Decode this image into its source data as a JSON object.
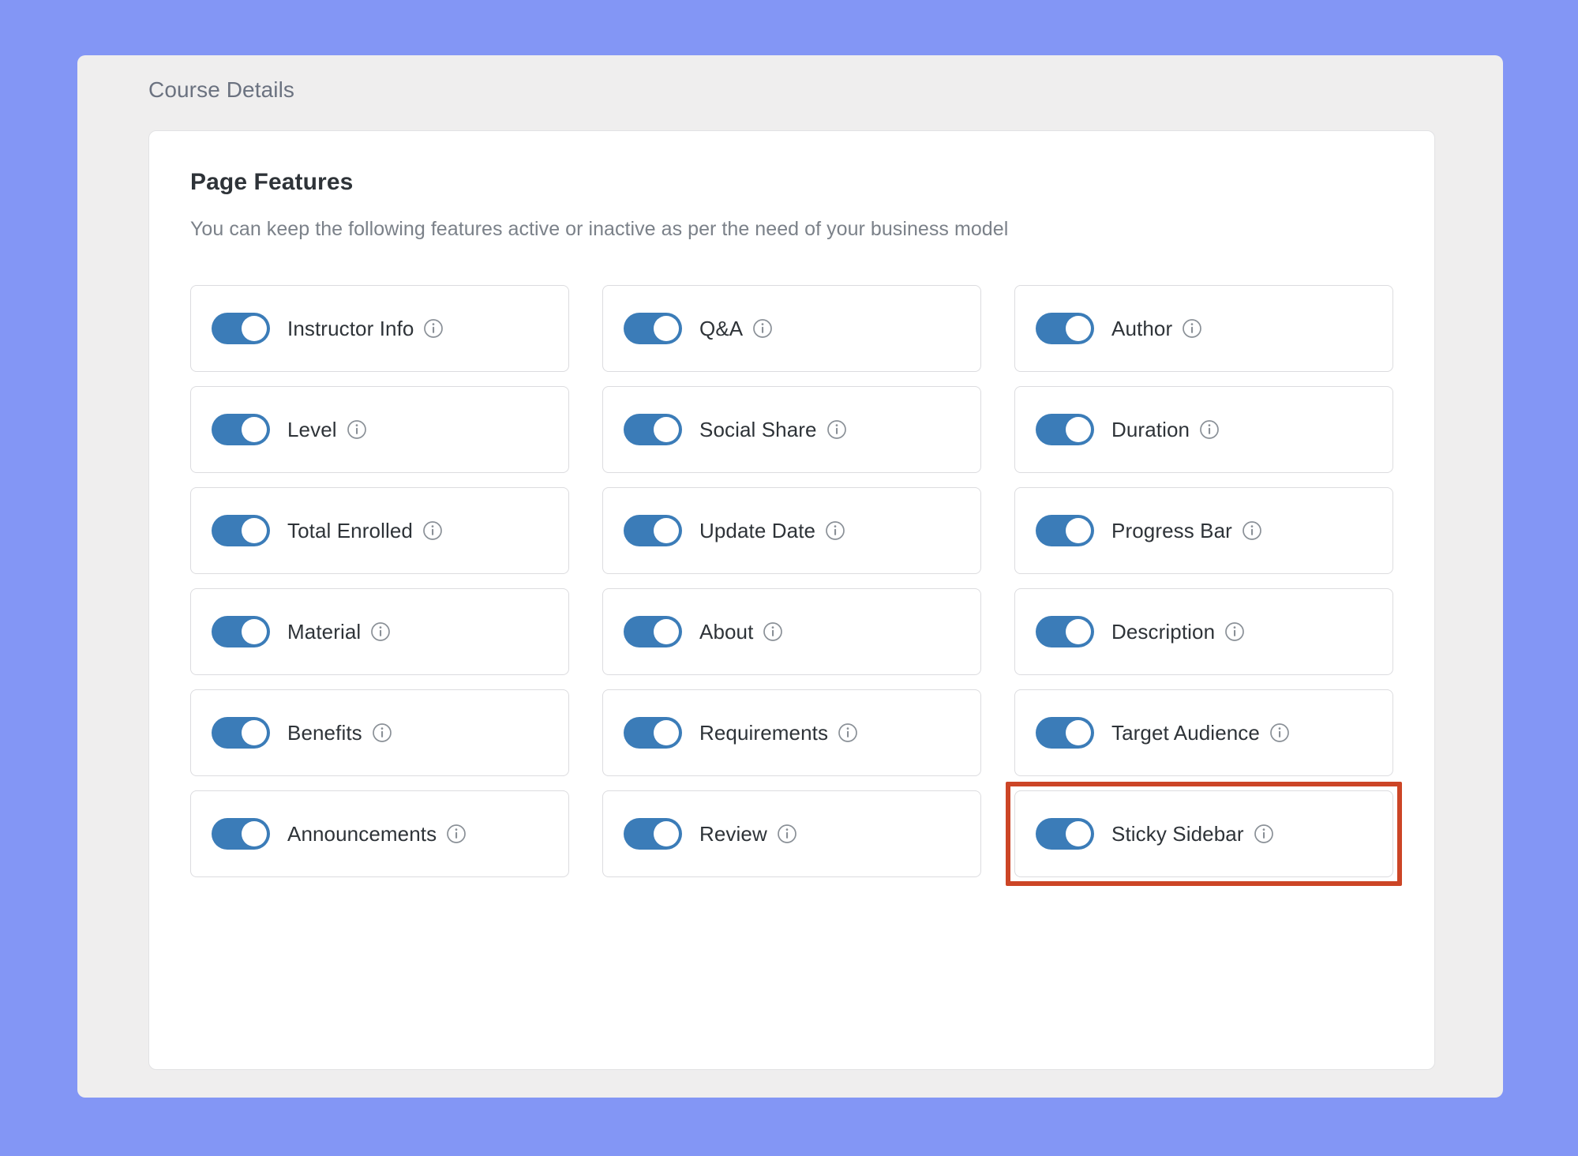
{
  "page": {
    "background_color": "#8396f5",
    "panel_color": "#efeeee",
    "card_color": "#ffffff",
    "accent_color": "#3b7cb8",
    "highlight_color": "#cc4526"
  },
  "panel": {
    "title": "Course Details"
  },
  "section": {
    "title": "Page Features",
    "subtitle": "You can keep the following features active or inactive as per the need of your business model"
  },
  "icons": {
    "info": "info-icon"
  },
  "features": [
    {
      "label": "Instructor Info",
      "enabled": true,
      "highlighted": false
    },
    {
      "label": "Q&A",
      "enabled": true,
      "highlighted": false
    },
    {
      "label": "Author",
      "enabled": true,
      "highlighted": false
    },
    {
      "label": "Level",
      "enabled": true,
      "highlighted": false
    },
    {
      "label": "Social Share",
      "enabled": true,
      "highlighted": false
    },
    {
      "label": "Duration",
      "enabled": true,
      "highlighted": false
    },
    {
      "label": "Total Enrolled",
      "enabled": true,
      "highlighted": false
    },
    {
      "label": "Update Date",
      "enabled": true,
      "highlighted": false
    },
    {
      "label": "Progress Bar",
      "enabled": true,
      "highlighted": false
    },
    {
      "label": "Material",
      "enabled": true,
      "highlighted": false
    },
    {
      "label": "About",
      "enabled": true,
      "highlighted": false
    },
    {
      "label": "Description",
      "enabled": true,
      "highlighted": false
    },
    {
      "label": "Benefits",
      "enabled": true,
      "highlighted": false
    },
    {
      "label": "Requirements",
      "enabled": true,
      "highlighted": false
    },
    {
      "label": "Target Audience",
      "enabled": true,
      "highlighted": false
    },
    {
      "label": "Announcements",
      "enabled": true,
      "highlighted": false
    },
    {
      "label": "Review",
      "enabled": true,
      "highlighted": false
    },
    {
      "label": "Sticky Sidebar",
      "enabled": true,
      "highlighted": true
    }
  ]
}
